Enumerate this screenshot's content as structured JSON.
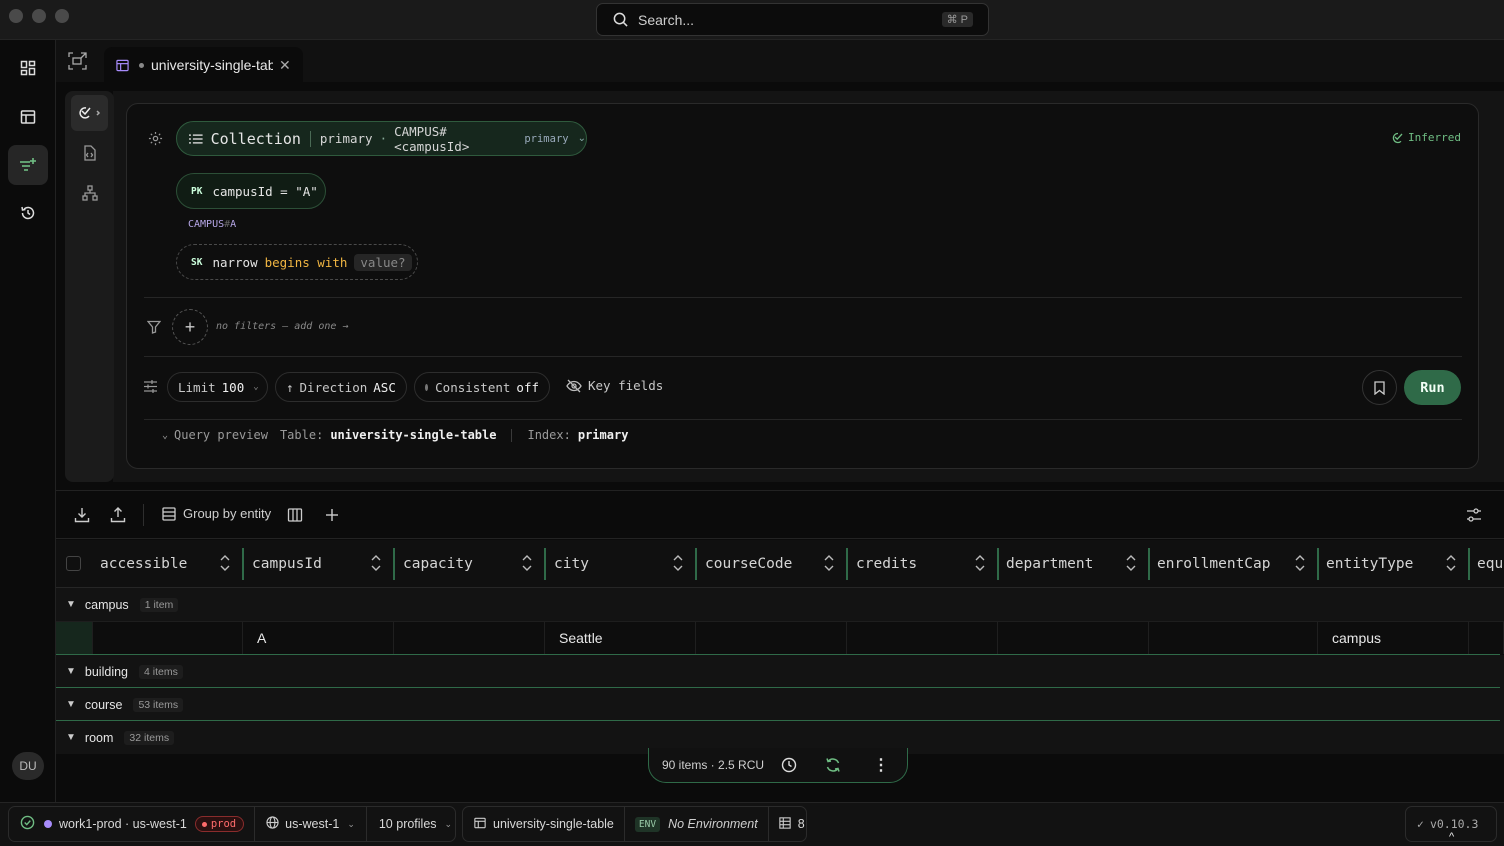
{
  "titlebar": {
    "search_placeholder": "Search...",
    "shortcut": "⌘ P"
  },
  "rail": {
    "avatar": "DU"
  },
  "tab": {
    "title": "university-single-table"
  },
  "query": {
    "collection_label": "Collection",
    "index_name": "primary",
    "key_pattern": "CAMPUS#<campusId>",
    "index_tag": "primary",
    "inferred_label": "Inferred",
    "pk_badge": "PK",
    "pk_expr": "campusId = \"A\"",
    "key_prefix": "CAMPUS",
    "key_hash": "#",
    "key_value": "A",
    "sk_badge": "SK",
    "sk_word": "narrow",
    "sk_op": "begins with",
    "sk_value": "value?",
    "no_filters": "no filters — add one →",
    "limit_label": "Limit",
    "limit_value": "100",
    "direction_label": "Direction",
    "direction_value": "ASC",
    "consistent_label": "Consistent",
    "consistent_value": "off",
    "key_fields": "Key fields",
    "run": "Run",
    "preview_label": "Query preview",
    "table_label": "Table:",
    "table_value": "university-single-table",
    "index_label": "Index:",
    "index_value": "primary"
  },
  "results": {
    "group_by": "Group by entity",
    "columns": [
      "accessible",
      "campusId",
      "capacity",
      "city",
      "courseCode",
      "credits",
      "department",
      "enrollmentCap",
      "entityType",
      "equ"
    ],
    "groups": [
      {
        "name": "campus",
        "count": "1 item"
      },
      {
        "name": "building",
        "count": "4 items"
      },
      {
        "name": "course",
        "count": "53 items"
      },
      {
        "name": "room",
        "count": "32 items"
      }
    ],
    "row": {
      "campusId": "A",
      "city": "Seattle",
      "entityType": "campus"
    },
    "status": "90 items · 2.5 RCU"
  },
  "footer": {
    "connection": "work1-prod · us-west-1",
    "prod_tag": "prod",
    "region": "us-west-1",
    "profiles": "10 profiles",
    "table": "university-single-table",
    "env_badge": "ENV",
    "environment": "No Environment",
    "table_count": "8",
    "version": "v0.10.3"
  },
  "colors": {
    "accent": "#2f6a48",
    "prod": "#ff6b6b",
    "operator": "#f0b542",
    "key_prefix": "#b7a7e8"
  }
}
